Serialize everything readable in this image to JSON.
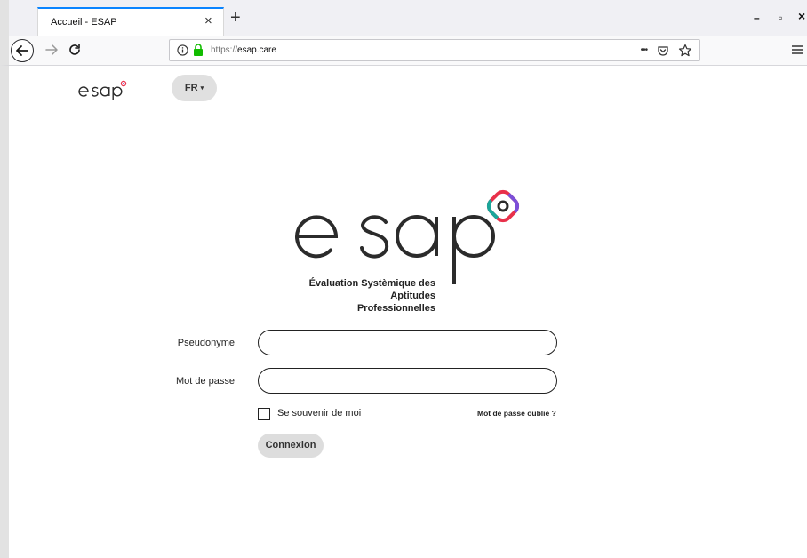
{
  "browser": {
    "tab_title": "Accueil - ESAP",
    "tab_close": "×",
    "new_tab": "+",
    "url_protocol": "https://",
    "url_host": "esap.care",
    "url_more": "•••",
    "window_minimize": "–",
    "window_maximize": "▫",
    "window_close": "×"
  },
  "header": {
    "logo_text": "esap",
    "language_label": "FR",
    "language_caret": "▾"
  },
  "hero": {
    "logo_text": "esap",
    "tagline_line1": "Évaluation Systèmique des Aptitudes",
    "tagline_line2": "Professionnelles"
  },
  "login_form": {
    "username_label": "Pseudonyme",
    "username_value": "",
    "password_label": "Mot de passe",
    "password_value": "",
    "remember_label": "Se souvenir de moi",
    "remember_checked": false,
    "forgot_label": "Mot de passe oublié ?",
    "submit_label": "Connexion"
  },
  "colors": {
    "accent_tab": "#0a84ff",
    "lock_green": "#12bc00",
    "logo_dark": "#2b2b2b",
    "logo_red": "#e8304a",
    "logo_purple": "#7b4fd8",
    "logo_teal": "#1aa69a"
  }
}
